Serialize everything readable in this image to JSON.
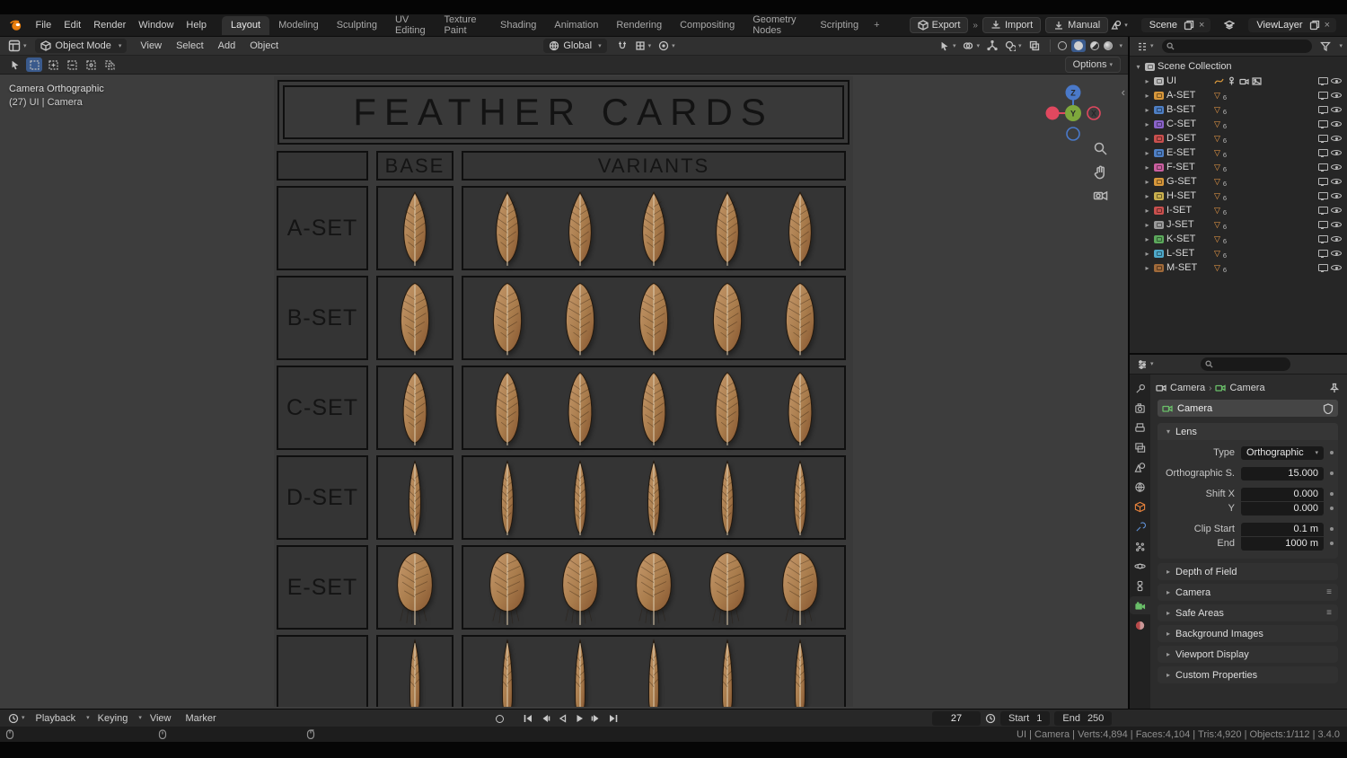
{
  "topbar": {
    "menus": [
      "File",
      "Edit",
      "Render",
      "Window",
      "Help"
    ],
    "tabs": [
      "Layout",
      "Modeling",
      "Sculpting",
      "UV Editing",
      "Texture Paint",
      "Shading",
      "Animation",
      "Rendering",
      "Compositing",
      "Geometry Nodes",
      "Scripting"
    ],
    "active_tab": "Layout",
    "new_tab": "+",
    "export_label": "Export",
    "import_label": "Import",
    "manual_label": "Manual",
    "scene_name": "Scene",
    "view_layer_name": "ViewLayer"
  },
  "icons": {
    "caret": "▾",
    "collapsed": "▸",
    "expanded": "▾",
    "close": "×",
    "chevrons": "»",
    "mesh": "▽",
    "menu_lines": "≡",
    "crumb_sep": "›",
    "sidebar_toggle": "‹"
  },
  "viewport": {
    "header": {
      "mode": "Object Mode",
      "menus": [
        "View",
        "Select",
        "Add",
        "Object"
      ],
      "orientation": "Global"
    },
    "tool_options_label": "Options",
    "overlay": {
      "line1": "Camera Orthographic",
      "line2": "(27) UI | Camera"
    },
    "gizmo": {
      "x": "X",
      "y": "Y",
      "z": "Z"
    }
  },
  "feather_table": {
    "title": "FEATHER CARDS",
    "columns": {
      "base": "BASE",
      "variants": "VARIANTS"
    },
    "rows": [
      {
        "label": "A-SET"
      },
      {
        "label": "B-SET"
      },
      {
        "label": "C-SET"
      },
      {
        "label": "D-SET"
      },
      {
        "label": "E-SET"
      },
      {
        "label": ""
      }
    ]
  },
  "outliner": {
    "root_label": "Scene Collection",
    "items": [
      {
        "label": "UI",
        "color": "#b9b9b9"
      },
      {
        "label": "A-SET",
        "count": "6",
        "color": "#d7973b"
      },
      {
        "label": "B-SET",
        "count": "6",
        "color": "#4e7fc4"
      },
      {
        "label": "C-SET",
        "count": "6",
        "color": "#8a63c9"
      },
      {
        "label": "D-SET",
        "count": "6",
        "color": "#c9504e"
      },
      {
        "label": "E-SET",
        "count": "6",
        "color": "#4e7fc4"
      },
      {
        "label": "F-SET",
        "count": "6",
        "color": "#c95f9f"
      },
      {
        "label": "G-SET",
        "count": "6",
        "color": "#d7973b"
      },
      {
        "label": "H-SET",
        "count": "6",
        "color": "#c9b04e"
      },
      {
        "label": "I-SET",
        "count": "6",
        "color": "#c9504e"
      },
      {
        "label": "J-SET",
        "count": "6",
        "color": "#9a9a9a"
      },
      {
        "label": "K-SET",
        "count": "6",
        "color": "#5ca85c"
      },
      {
        "label": "L-SET",
        "count": "6",
        "color": "#4ea8c9"
      },
      {
        "label": "M-SET",
        "count": "6",
        "color": "#a06a3a"
      }
    ]
  },
  "properties": {
    "breadcrumb": {
      "object": "Camera",
      "data": "Camera"
    },
    "name_field": "Camera",
    "lens_panel": {
      "title": "Lens",
      "rows": [
        {
          "label": "Type",
          "value": "Orthographic"
        },
        {
          "label": "Orthographic S.",
          "value": "15.000"
        },
        {
          "label": "Shift X",
          "value": "0.000"
        },
        {
          "label": "Y",
          "value": "0.000"
        },
        {
          "label": "Clip Start",
          "value": "0.1 m"
        },
        {
          "label": "End",
          "value": "1000 m"
        }
      ]
    },
    "collapsed_panels": [
      {
        "title": "Depth of Field"
      },
      {
        "title": "Camera"
      },
      {
        "title": "Safe Areas"
      },
      {
        "title": "Background Images"
      },
      {
        "title": "Viewport Display"
      },
      {
        "title": "Custom Properties"
      }
    ]
  },
  "timeline": {
    "menus": [
      "Playback",
      "Keying",
      "View",
      "Marker"
    ],
    "current_frame": "27",
    "start_label": "Start",
    "start_value": "1",
    "end_label": "End",
    "end_value": "250"
  },
  "status_bar": {
    "info": "UI | Camera | Verts:4,894 | Faces:4,104 | Tris:4,920 | Objects:1/112 | 3.4.0"
  },
  "colors": {
    "axis_x": "#e0485f",
    "axis_y": "#7ea83c",
    "axis_z": "#4a79c9",
    "mesh_icon": "#ef9d48",
    "object_icon": "#e8823c",
    "modifier_icon": "#5f8fd3",
    "camera_data_icon": "#6abf69",
    "material_icon": "#b84a4a",
    "active_tool": "#3a5a8c"
  }
}
